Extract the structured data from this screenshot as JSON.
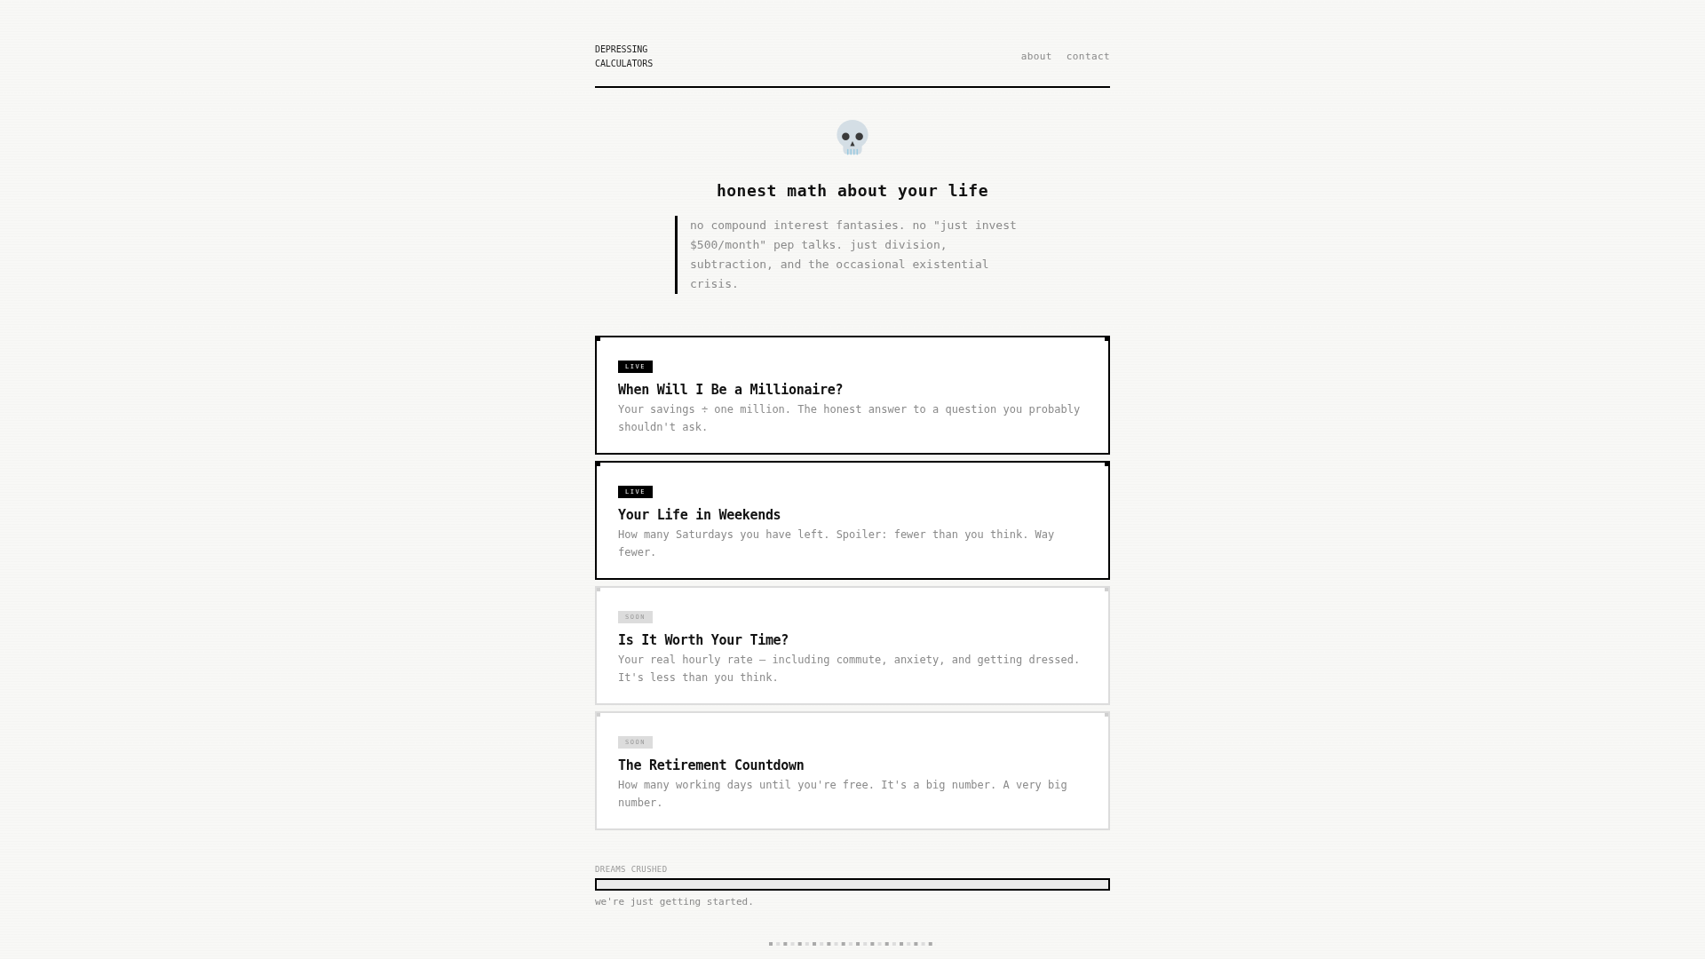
{
  "header": {
    "logo": "DEPRESSING CALCULATORS",
    "nav": [
      "about",
      "contact"
    ]
  },
  "hero": {
    "title": "honest math about your life",
    "quote": "no compound interest fantasies. no \"just invest $500/month\" pep talks. just division, subtraction, and the occasional existential crisis."
  },
  "calculators": [
    {
      "kind": "live",
      "badge": "LIVE",
      "title": "When Will I Be a Millionaire?",
      "description": "Your savings ÷ one million. The honest answer to a question you probably shouldn't ask."
    },
    {
      "kind": "live",
      "badge": "LIVE",
      "title": "Your Life in Weekends",
      "description": "How many Saturdays you have left. Spoiler: fewer than you think. Way fewer."
    },
    {
      "kind": "soon",
      "badge": "SOON",
      "title": "Is It Worth Your Time?",
      "description": "Your real hourly rate — including commute, anxiety, and getting dressed. It's less than you think."
    },
    {
      "kind": "soon",
      "badge": "SOON",
      "title": "The Retirement Countdown",
      "description": "How many working days until you're free. It's a big number. A very big number."
    }
  ],
  "progress": {
    "label": "DREAMS CRUSHED",
    "level": 0,
    "caption": "we're just getting started."
  }
}
